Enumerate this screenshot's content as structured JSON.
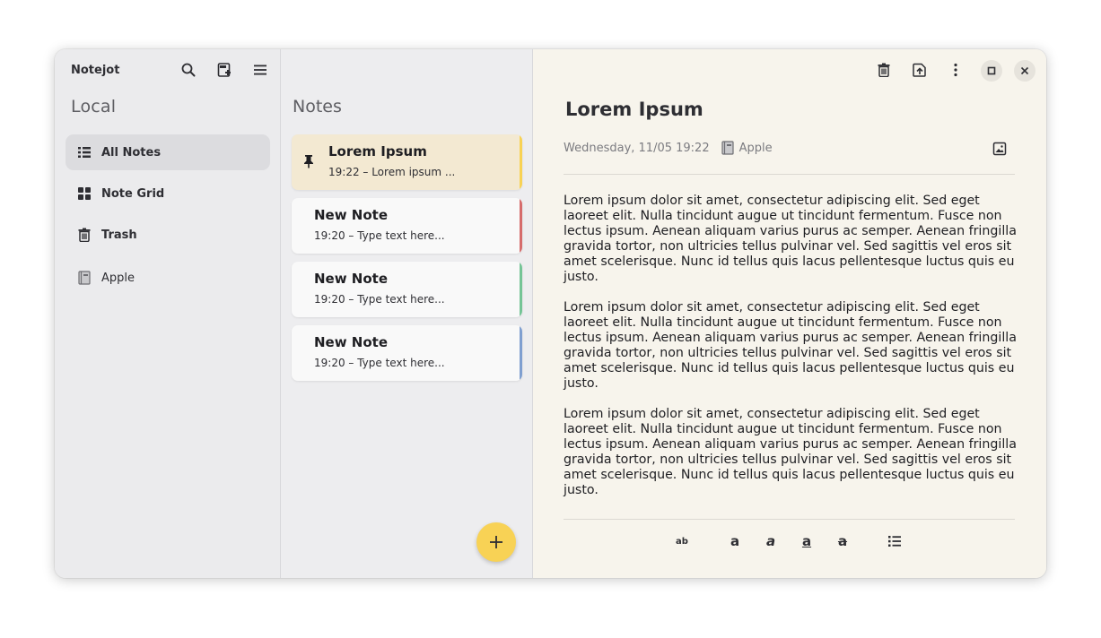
{
  "app": {
    "title": "Notejot"
  },
  "sidebar": {
    "section_title": "Local",
    "items": [
      {
        "label": "All Notes",
        "icon": "list-icon",
        "active": true
      },
      {
        "label": "Note Grid",
        "icon": "grid-icon",
        "active": false
      },
      {
        "label": "Trash",
        "icon": "trash-icon",
        "active": false
      }
    ],
    "notebooks": [
      {
        "label": "Apple",
        "icon": "notebook-icon"
      }
    ]
  },
  "list": {
    "title": "Notes",
    "notes": [
      {
        "title": "Lorem Ipsum",
        "subtitle": "19:22 – Lorem ipsum ...",
        "pinned": true,
        "color": "#f8d255"
      },
      {
        "title": "New Note",
        "subtitle": "19:20 – Type text here...",
        "pinned": false,
        "color": "#d66c6c"
      },
      {
        "title": "New Note",
        "subtitle": "19:20 – Type text here...",
        "pinned": false,
        "color": "#74c496"
      },
      {
        "title": "New Note",
        "subtitle": "19:20 – Type text here...",
        "pinned": false,
        "color": "#7f9fd0"
      }
    ],
    "new_note_icon": "plus-icon"
  },
  "editor": {
    "title": "Lorem Ipsum",
    "date": "Wednesday, 11/05 19:22",
    "notebook": "Apple",
    "paragraphs": [
      "Lorem ipsum dolor sit amet, consectetur adipiscing elit. Sed eget laoreet elit. Nulla tincidunt augue ut tincidunt fermentum. Fusce non lectus ipsum. Aenean aliquam varius purus ac semper. Aenean fringilla gravida tortor, non ultricies tellus pulvinar vel. Sed sagittis vel eros sit amet scelerisque. Nunc id tellus quis lacus pellentesque luctus quis eu justo.",
      "Lorem ipsum dolor sit amet, consectetur adipiscing elit. Sed eget laoreet elit. Nulla tincidunt augue ut tincidunt fermentum. Fusce non lectus ipsum. Aenean aliquam varius purus ac semper. Aenean fringilla gravida tortor, non ultricies tellus pulvinar vel. Sed sagittis vel eros sit amet scelerisque. Nunc id tellus quis lacus pellentesque luctus quis eu justo.",
      "Lorem ipsum dolor sit amet, consectetur adipiscing elit. Sed eget laoreet elit. Nulla tincidunt augue ut tincidunt fermentum. Fusce non lectus ipsum. Aenean aliquam varius purus ac semper. Aenean fringilla gravida tortor, non ultricies tellus pulvinar vel. Sed sagittis vel eros sit amet scelerisque. Nunc id tellus quis lacus pellentesque luctus quis eu justo."
    ],
    "format_buttons": [
      {
        "name": "normal-text-icon",
        "glyph": "ab"
      },
      {
        "name": "bold-icon",
        "glyph": "a"
      },
      {
        "name": "italic-icon",
        "glyph": "a"
      },
      {
        "name": "underline-icon",
        "glyph": "a"
      },
      {
        "name": "strikethrough-icon",
        "glyph": "a"
      },
      {
        "name": "bullet-list-icon",
        "glyph": ""
      }
    ]
  },
  "colors": {
    "accent": "#f8d255",
    "pinned_card_bg": "#f3e9d2",
    "editor_bg": "#f7f4ec"
  }
}
